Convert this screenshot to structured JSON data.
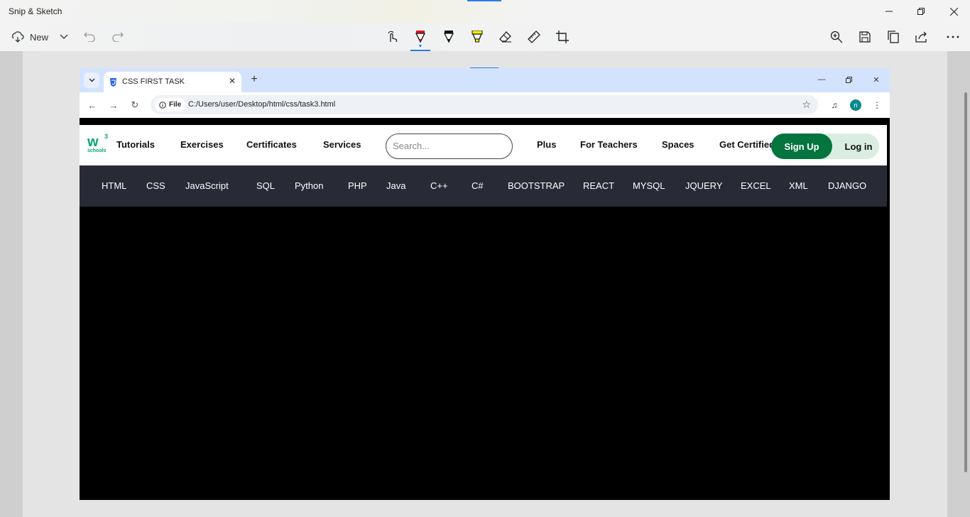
{
  "app": {
    "title": "Snip & Sketch",
    "new_label": "New"
  },
  "tools": [
    {
      "name": "touch-writing-icon"
    },
    {
      "name": "ballpoint-pen-icon",
      "active": true
    },
    {
      "name": "pencil-icon"
    },
    {
      "name": "highlighter-icon"
    },
    {
      "name": "eraser-icon"
    },
    {
      "name": "ruler-icon"
    },
    {
      "name": "crop-icon"
    }
  ],
  "colors": {
    "ballpoint": "#e81123",
    "highlighter": "#fff100",
    "accent": "#2c7be5",
    "w3_green": "#04aa6d",
    "w3_dark": "#282a35"
  },
  "browser": {
    "tab_title": "CSS FIRST TASK",
    "file_chip": "File",
    "url": "C:/Users/user/Desktop/html/css/task3.html",
    "avatar_letter": "n"
  },
  "w3": {
    "logo_mark": "w",
    "logo_sup": "3",
    "logo_sub": "schools",
    "nav": [
      "Tutorials",
      "Exercises",
      "Certificates",
      "Services"
    ],
    "search_placeholder": "Search...",
    "nav_right": [
      "Plus",
      "For Teachers",
      "Spaces"
    ],
    "nav_clipped": "Get Certified",
    "signup": "Sign Up",
    "login": "Log in",
    "subnav": [
      "HTML",
      "CSS",
      "JavaScript",
      "SQL",
      "Python",
      "PHP",
      "Java",
      "C++",
      "C#",
      "BOOTSTRAP",
      "REACT",
      "MYSQL",
      "JQUERY",
      "EXCEL",
      "XML",
      "DJANGO"
    ]
  }
}
